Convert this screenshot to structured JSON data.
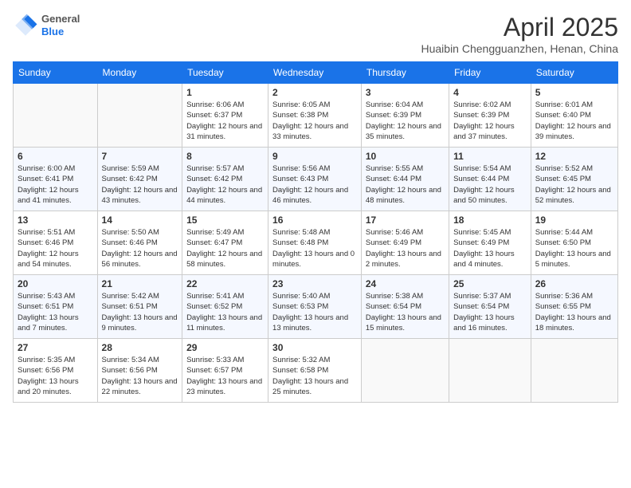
{
  "header": {
    "logo_general": "General",
    "logo_blue": "Blue",
    "title": "April 2025",
    "subtitle": "Huaibin Chengguanzhen, Henan, China"
  },
  "weekdays": [
    "Sunday",
    "Monday",
    "Tuesday",
    "Wednesday",
    "Thursday",
    "Friday",
    "Saturday"
  ],
  "weeks": [
    [
      {
        "day": "",
        "empty": true
      },
      {
        "day": "",
        "empty": true
      },
      {
        "day": "1",
        "sunrise": "Sunrise: 6:06 AM",
        "sunset": "Sunset: 6:37 PM",
        "daylight": "Daylight: 12 hours and 31 minutes."
      },
      {
        "day": "2",
        "sunrise": "Sunrise: 6:05 AM",
        "sunset": "Sunset: 6:38 PM",
        "daylight": "Daylight: 12 hours and 33 minutes."
      },
      {
        "day": "3",
        "sunrise": "Sunrise: 6:04 AM",
        "sunset": "Sunset: 6:39 PM",
        "daylight": "Daylight: 12 hours and 35 minutes."
      },
      {
        "day": "4",
        "sunrise": "Sunrise: 6:02 AM",
        "sunset": "Sunset: 6:39 PM",
        "daylight": "Daylight: 12 hours and 37 minutes."
      },
      {
        "day": "5",
        "sunrise": "Sunrise: 6:01 AM",
        "sunset": "Sunset: 6:40 PM",
        "daylight": "Daylight: 12 hours and 39 minutes."
      }
    ],
    [
      {
        "day": "6",
        "sunrise": "Sunrise: 6:00 AM",
        "sunset": "Sunset: 6:41 PM",
        "daylight": "Daylight: 12 hours and 41 minutes."
      },
      {
        "day": "7",
        "sunrise": "Sunrise: 5:59 AM",
        "sunset": "Sunset: 6:42 PM",
        "daylight": "Daylight: 12 hours and 43 minutes."
      },
      {
        "day": "8",
        "sunrise": "Sunrise: 5:57 AM",
        "sunset": "Sunset: 6:42 PM",
        "daylight": "Daylight: 12 hours and 44 minutes."
      },
      {
        "day": "9",
        "sunrise": "Sunrise: 5:56 AM",
        "sunset": "Sunset: 6:43 PM",
        "daylight": "Daylight: 12 hours and 46 minutes."
      },
      {
        "day": "10",
        "sunrise": "Sunrise: 5:55 AM",
        "sunset": "Sunset: 6:44 PM",
        "daylight": "Daylight: 12 hours and 48 minutes."
      },
      {
        "day": "11",
        "sunrise": "Sunrise: 5:54 AM",
        "sunset": "Sunset: 6:44 PM",
        "daylight": "Daylight: 12 hours and 50 minutes."
      },
      {
        "day": "12",
        "sunrise": "Sunrise: 5:52 AM",
        "sunset": "Sunset: 6:45 PM",
        "daylight": "Daylight: 12 hours and 52 minutes."
      }
    ],
    [
      {
        "day": "13",
        "sunrise": "Sunrise: 5:51 AM",
        "sunset": "Sunset: 6:46 PM",
        "daylight": "Daylight: 12 hours and 54 minutes."
      },
      {
        "day": "14",
        "sunrise": "Sunrise: 5:50 AM",
        "sunset": "Sunset: 6:46 PM",
        "daylight": "Daylight: 12 hours and 56 minutes."
      },
      {
        "day": "15",
        "sunrise": "Sunrise: 5:49 AM",
        "sunset": "Sunset: 6:47 PM",
        "daylight": "Daylight: 12 hours and 58 minutes."
      },
      {
        "day": "16",
        "sunrise": "Sunrise: 5:48 AM",
        "sunset": "Sunset: 6:48 PM",
        "daylight": "Daylight: 13 hours and 0 minutes."
      },
      {
        "day": "17",
        "sunrise": "Sunrise: 5:46 AM",
        "sunset": "Sunset: 6:49 PM",
        "daylight": "Daylight: 13 hours and 2 minutes."
      },
      {
        "day": "18",
        "sunrise": "Sunrise: 5:45 AM",
        "sunset": "Sunset: 6:49 PM",
        "daylight": "Daylight: 13 hours and 4 minutes."
      },
      {
        "day": "19",
        "sunrise": "Sunrise: 5:44 AM",
        "sunset": "Sunset: 6:50 PM",
        "daylight": "Daylight: 13 hours and 5 minutes."
      }
    ],
    [
      {
        "day": "20",
        "sunrise": "Sunrise: 5:43 AM",
        "sunset": "Sunset: 6:51 PM",
        "daylight": "Daylight: 13 hours and 7 minutes."
      },
      {
        "day": "21",
        "sunrise": "Sunrise: 5:42 AM",
        "sunset": "Sunset: 6:51 PM",
        "daylight": "Daylight: 13 hours and 9 minutes."
      },
      {
        "day": "22",
        "sunrise": "Sunrise: 5:41 AM",
        "sunset": "Sunset: 6:52 PM",
        "daylight": "Daylight: 13 hours and 11 minutes."
      },
      {
        "day": "23",
        "sunrise": "Sunrise: 5:40 AM",
        "sunset": "Sunset: 6:53 PM",
        "daylight": "Daylight: 13 hours and 13 minutes."
      },
      {
        "day": "24",
        "sunrise": "Sunrise: 5:38 AM",
        "sunset": "Sunset: 6:54 PM",
        "daylight": "Daylight: 13 hours and 15 minutes."
      },
      {
        "day": "25",
        "sunrise": "Sunrise: 5:37 AM",
        "sunset": "Sunset: 6:54 PM",
        "daylight": "Daylight: 13 hours and 16 minutes."
      },
      {
        "day": "26",
        "sunrise": "Sunrise: 5:36 AM",
        "sunset": "Sunset: 6:55 PM",
        "daylight": "Daylight: 13 hours and 18 minutes."
      }
    ],
    [
      {
        "day": "27",
        "sunrise": "Sunrise: 5:35 AM",
        "sunset": "Sunset: 6:56 PM",
        "daylight": "Daylight: 13 hours and 20 minutes."
      },
      {
        "day": "28",
        "sunrise": "Sunrise: 5:34 AM",
        "sunset": "Sunset: 6:56 PM",
        "daylight": "Daylight: 13 hours and 22 minutes."
      },
      {
        "day": "29",
        "sunrise": "Sunrise: 5:33 AM",
        "sunset": "Sunset: 6:57 PM",
        "daylight": "Daylight: 13 hours and 23 minutes."
      },
      {
        "day": "30",
        "sunrise": "Sunrise: 5:32 AM",
        "sunset": "Sunset: 6:58 PM",
        "daylight": "Daylight: 13 hours and 25 minutes."
      },
      {
        "day": "",
        "empty": true
      },
      {
        "day": "",
        "empty": true
      },
      {
        "day": "",
        "empty": true
      }
    ]
  ]
}
